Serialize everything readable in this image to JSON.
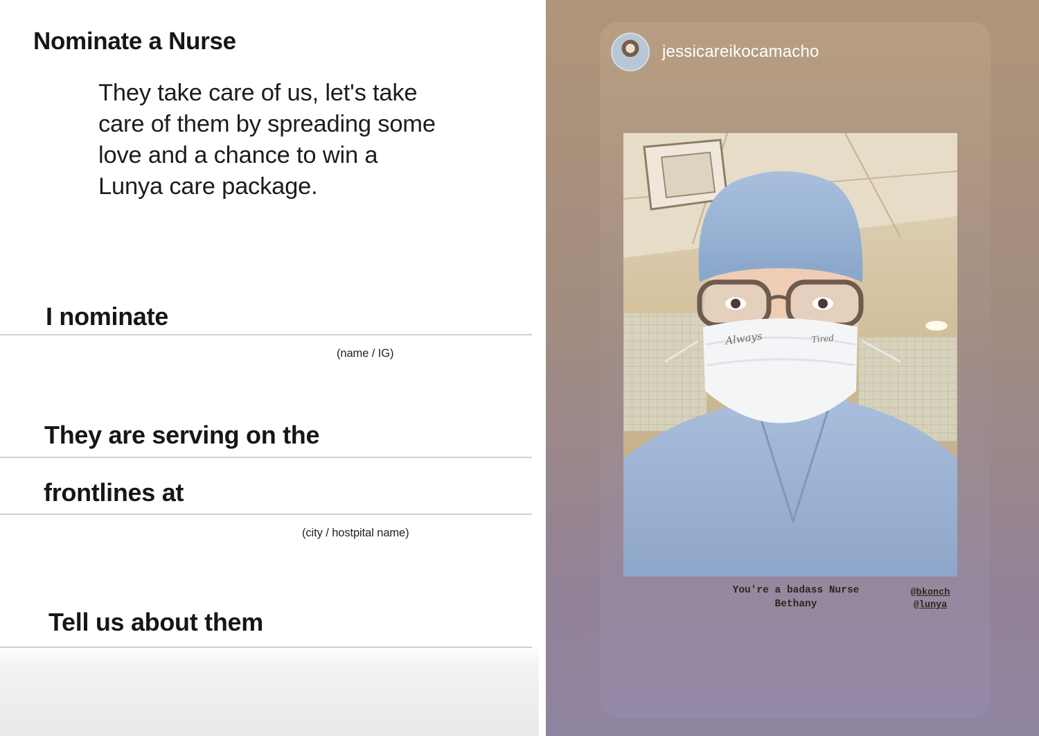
{
  "form": {
    "title": "Nominate a Nurse",
    "intro_lines": [
      "They take care of us, let's take",
      "care of them by spreading some",
      "love and a chance to win a",
      "Lunya care package."
    ],
    "nominate_label": "I nominate",
    "nominate_hint": "(name / IG)",
    "serving_label_1": "They are serving on the",
    "serving_label_2": "frontlines at",
    "serving_hint": "(city / hostpital name)",
    "tell_label": "Tell us about them"
  },
  "story": {
    "username": "jessicareikocamacho",
    "caption_line_1": "You're a badass Nurse",
    "caption_line_2": "Bethany",
    "tag_1_prefix": "@",
    "tag_1": "bkonch",
    "tag_2_prefix": "@",
    "tag_2": "lunya",
    "mask_text_left": "Always",
    "mask_text_right": "Tired"
  },
  "colors": {
    "story_bg_top": "#b09579",
    "story_bg_bottom": "#8f84a0",
    "scrubs": "#9fb6d6"
  }
}
